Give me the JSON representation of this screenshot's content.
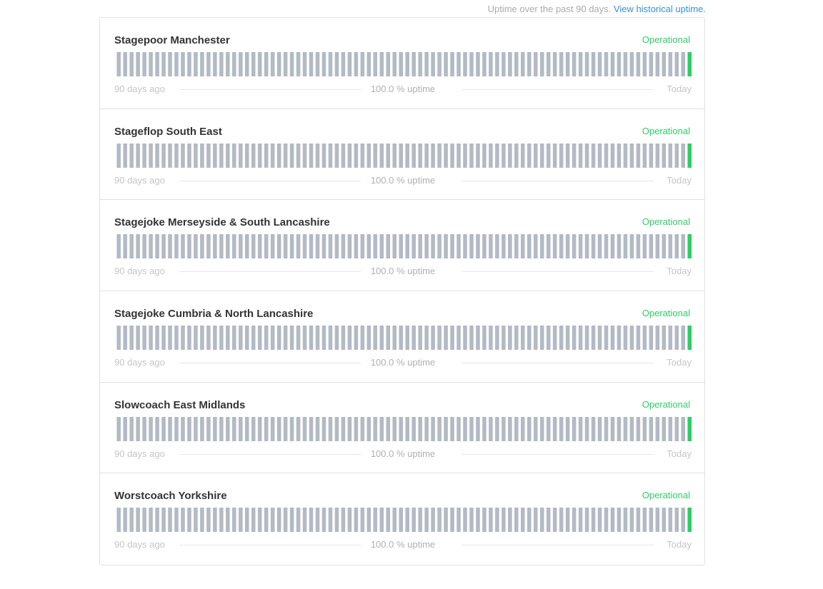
{
  "header": {
    "uptime_text": "Uptime over the past 90 days.",
    "history_link": "View historical uptime."
  },
  "colors": {
    "bar_no_data": "#b3bac5",
    "bar_operational": "#2fcc66",
    "status_operational": "#2fcc66"
  },
  "bar_days": 90,
  "components": [
    {
      "name": "Stagepoor Manchester",
      "status": "Operational",
      "left_label": "90 days ago",
      "uptime_label": "100.0 % uptime",
      "right_label": "Today",
      "operational_days": 1
    },
    {
      "name": "Stageflop South East",
      "status": "Operational",
      "left_label": "90 days ago",
      "uptime_label": "100.0 % uptime",
      "right_label": "Today",
      "operational_days": 1
    },
    {
      "name": "Stagejoke Merseyside & South Lancashire",
      "status": "Operational",
      "left_label": "90 days ago",
      "uptime_label": "100.0 % uptime",
      "right_label": "Today",
      "operational_days": 1
    },
    {
      "name": "Stagejoke Cumbria & North Lancashire",
      "status": "Operational",
      "left_label": "90 days ago",
      "uptime_label": "100.0 % uptime",
      "right_label": "Today",
      "operational_days": 1
    },
    {
      "name": "Slowcoach East Midlands",
      "status": "Operational",
      "left_label": "90 days ago",
      "uptime_label": "100.0 % uptime",
      "right_label": "Today",
      "operational_days": 1
    },
    {
      "name": "Worstcoach Yorkshire",
      "status": "Operational",
      "left_label": "90 days ago",
      "uptime_label": "100.0 % uptime",
      "right_label": "Today",
      "operational_days": 1
    }
  ]
}
